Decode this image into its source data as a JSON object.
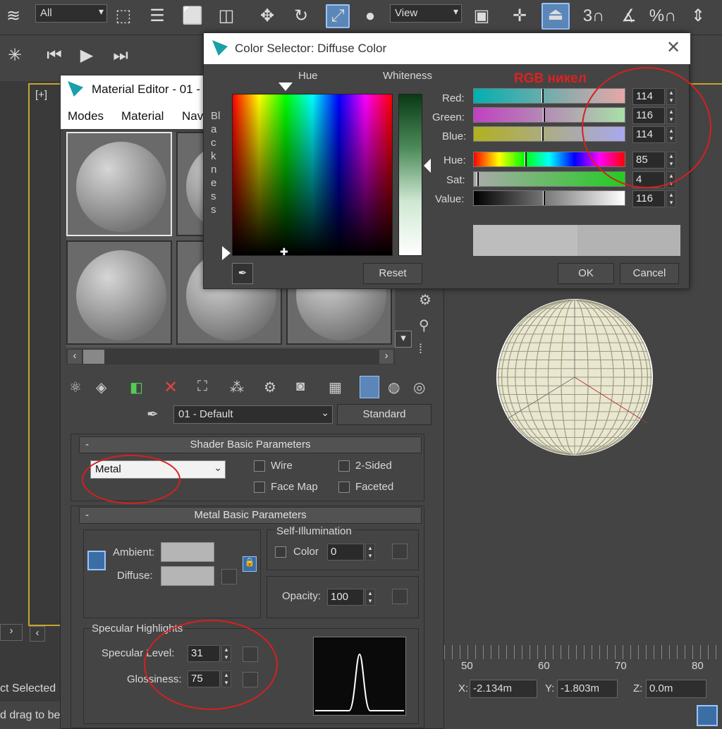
{
  "toolbar": {
    "selection_filter": "All",
    "reference_coord": "View",
    "snap_labels": [
      "3",
      "%"
    ]
  },
  "material_editor": {
    "title": "Material Editor - 01 -",
    "menu": [
      "Modes",
      "Material",
      "Nav"
    ],
    "material_name": "01 - Default",
    "material_type": "Standard",
    "shader_rollout": {
      "title": "Shader Basic Parameters",
      "shader": "Metal",
      "wire": "Wire",
      "two_sided": "2-Sided",
      "face_map": "Face Map",
      "faceted": "Faceted"
    },
    "metal_rollout": {
      "title": "Metal Basic Parameters",
      "ambient": "Ambient:",
      "diffuse": "Diffuse:",
      "self_illum": "Self-Illumination",
      "color": "Color",
      "color_value": "0",
      "opacity": "Opacity:",
      "opacity_value": "100"
    },
    "specular": {
      "title": "Specular Highlights",
      "level_label": "Specular Level:",
      "level_value": "31",
      "gloss_label": "Glossiness:",
      "gloss_value": "75"
    }
  },
  "color_selector": {
    "title": "Color Selector: Diffuse Color",
    "hue_label": "Hue",
    "whiteness_label": "Whiteness",
    "blackness_label": "Blackness",
    "annotation": "RGB никел",
    "red_label": "Red:",
    "green_label": "Green:",
    "blue_label": "Blue:",
    "hue2_label": "Hue:",
    "sat_label": "Sat:",
    "value_label": "Value:",
    "red": "114",
    "green": "116",
    "blue": "114",
    "hue": "85",
    "sat": "4",
    "value": "116",
    "reset": "Reset",
    "ok": "OK",
    "cancel": "Cancel"
  },
  "status": {
    "selected": "ct Selected",
    "prompt": "d drag to be",
    "x_label": "X:",
    "x_value": "-2.134m",
    "y_label": "Y:",
    "y_value": "-1.803m",
    "z_label": "Z:",
    "z_value": "0.0m",
    "viewport_label": "[+]"
  },
  "timeline": {
    "ticks": [
      "50",
      "60",
      "70",
      "80"
    ]
  },
  "colors": {
    "annotation_red": "#d62020",
    "diffuse_swatch": "#b5b5b5",
    "wire_sphere": "#f2f0d8"
  }
}
